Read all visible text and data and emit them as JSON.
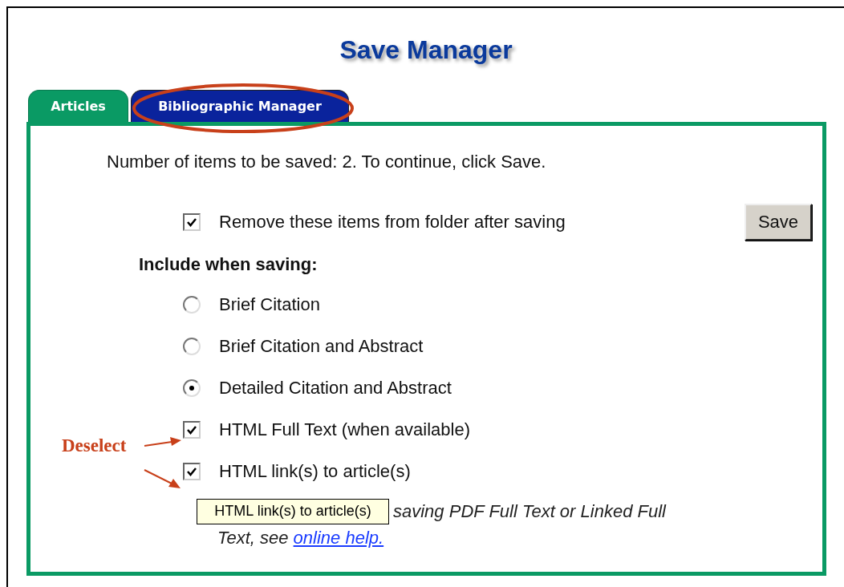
{
  "title": "Save Manager",
  "tabs": [
    {
      "label": "Articles",
      "selected": true
    },
    {
      "label": "Bibliographic Manager",
      "selected": false
    }
  ],
  "items_text": "Number of items to be saved: 2. To continue, click Save.",
  "remove_option": {
    "label": "Remove these items from folder after saving",
    "checked": true
  },
  "save_button": "Save",
  "include_heading": "Include when saving:",
  "citation_options": [
    {
      "label": "Brief Citation",
      "selected": false
    },
    {
      "label": "Brief Citation and Abstract",
      "selected": false
    },
    {
      "label": "Detailed Citation and Abstract",
      "selected": true
    }
  ],
  "extras": [
    {
      "label": "HTML Full Text (when available)",
      "checked": true
    },
    {
      "label": "HTML link(s) to article(s)",
      "checked": true
    }
  ],
  "note": {
    "line_1": "saving PDF Full Text or Linked Full",
    "line_2": "Text, see",
    "link": "online help."
  },
  "tooltip": "HTML link(s) to article(s)",
  "annotation": {
    "label": "Deselect"
  }
}
